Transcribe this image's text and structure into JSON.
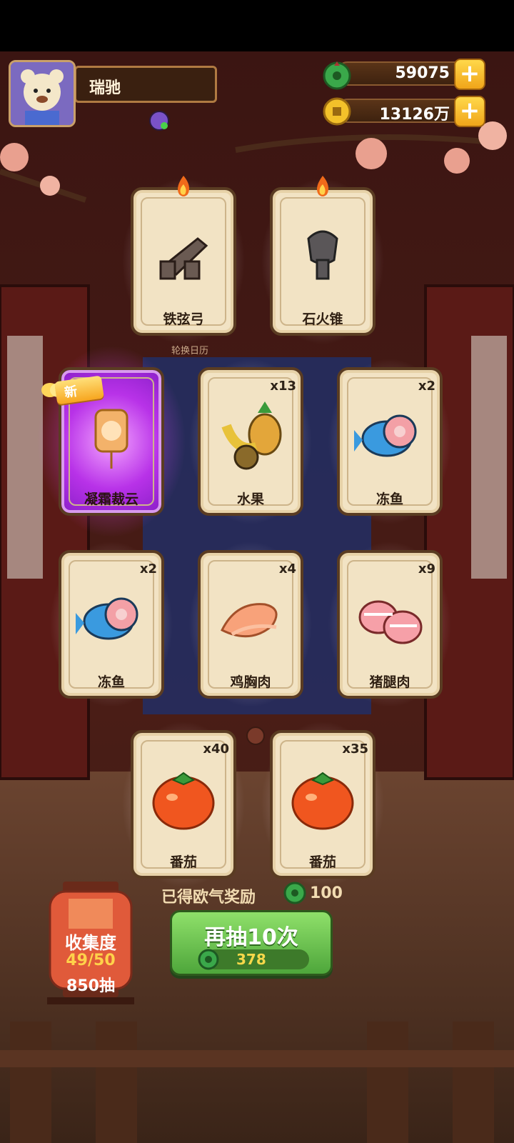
{
  "player": {
    "name": "瑞驰"
  },
  "currency": {
    "jade": {
      "value": "59075",
      "icon": "jade-coin-icon"
    },
    "gold": {
      "value": "13126万",
      "icon": "gold-coin-icon"
    },
    "plus_label": "+"
  },
  "background_sign": "轮换日历",
  "cards": [
    {
      "label": "铁弦弓",
      "count": "",
      "art": "crossbow-part",
      "hot": true
    },
    {
      "label": "石火锥",
      "count": "",
      "art": "stone-cone",
      "hot": true
    },
    {
      "label": "凝霜裁云",
      "count": "",
      "art": "decor-pendant",
      "rare": true,
      "new": true,
      "new_label": "新"
    },
    {
      "label": "水果",
      "count": "x13",
      "art": "fruit"
    },
    {
      "label": "冻鱼",
      "count": "x2",
      "art": "frozen-fish"
    },
    {
      "label": "冻鱼",
      "count": "x2",
      "art": "frozen-fish"
    },
    {
      "label": "鸡胸肉",
      "count": "x4",
      "art": "chicken-breast"
    },
    {
      "label": "猪腿肉",
      "count": "x9",
      "art": "pork-leg"
    },
    {
      "label": "番茄",
      "count": "x40",
      "art": "tomato"
    },
    {
      "label": "番茄",
      "count": "x35",
      "art": "tomato"
    }
  ],
  "reward": {
    "label": "已得欧气奖励",
    "value": "100"
  },
  "draw_button": {
    "label": "再抽10次",
    "cost": "378"
  },
  "collection": {
    "title": "收集度",
    "progress": "49/50",
    "draws": "850抽"
  }
}
